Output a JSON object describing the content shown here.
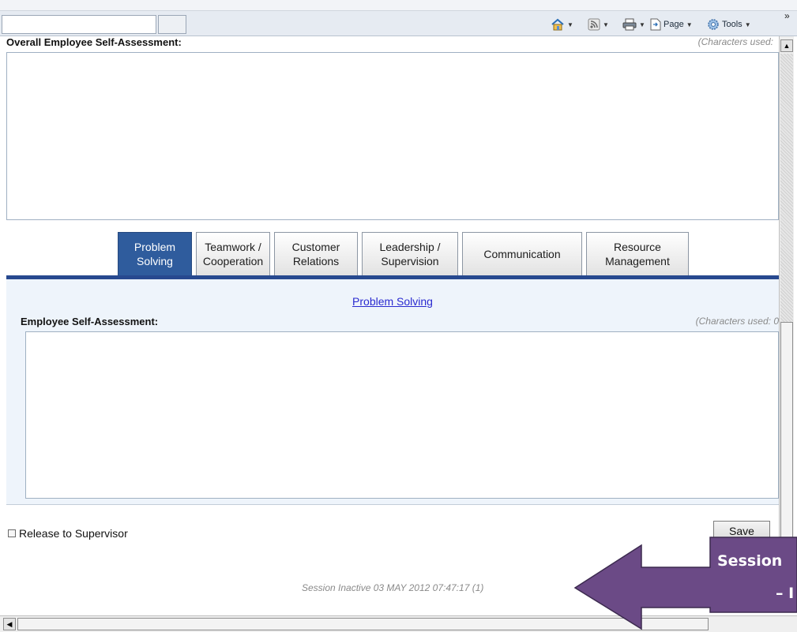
{
  "toolbar": {
    "page_label": "Page",
    "tools_label": "Tools",
    "overflow": "»",
    "icons": [
      "home-icon",
      "feeds-icon",
      "print-icon",
      "page-icon",
      "tools-gear-icon"
    ]
  },
  "overall": {
    "label": "Overall Employee Self-Assessment:",
    "chars_used": "(Characters used:"
  },
  "tabs": [
    {
      "label": "Problem\nSolving",
      "active": true
    },
    {
      "label": "Teamwork /\nCooperation",
      "active": false
    },
    {
      "label": "Customer\nRelations",
      "active": false
    },
    {
      "label": "Leadership /\nSupervision",
      "active": false
    },
    {
      "label": "Communication",
      "active": false
    },
    {
      "label": "Resource\nManagement",
      "active": false
    }
  ],
  "panel": {
    "heading_link": "Problem Solving",
    "label": "Employee Self-Assessment:",
    "chars_used": "(Characters used: 0"
  },
  "footer": {
    "release_label": "Release to Supervisor",
    "save_label": "Save",
    "session_status": "Session Inactive 03 MAY 2012 07:47:17 (1)"
  },
  "callout": {
    "line1": "Session",
    "line2": "– I",
    "color": "#6b4a86"
  },
  "colors": {
    "active_tab": "#2f5c9d",
    "tab_rule": "#27498f",
    "panel_bg": "#eef4fb",
    "link": "#2a2ad0"
  }
}
